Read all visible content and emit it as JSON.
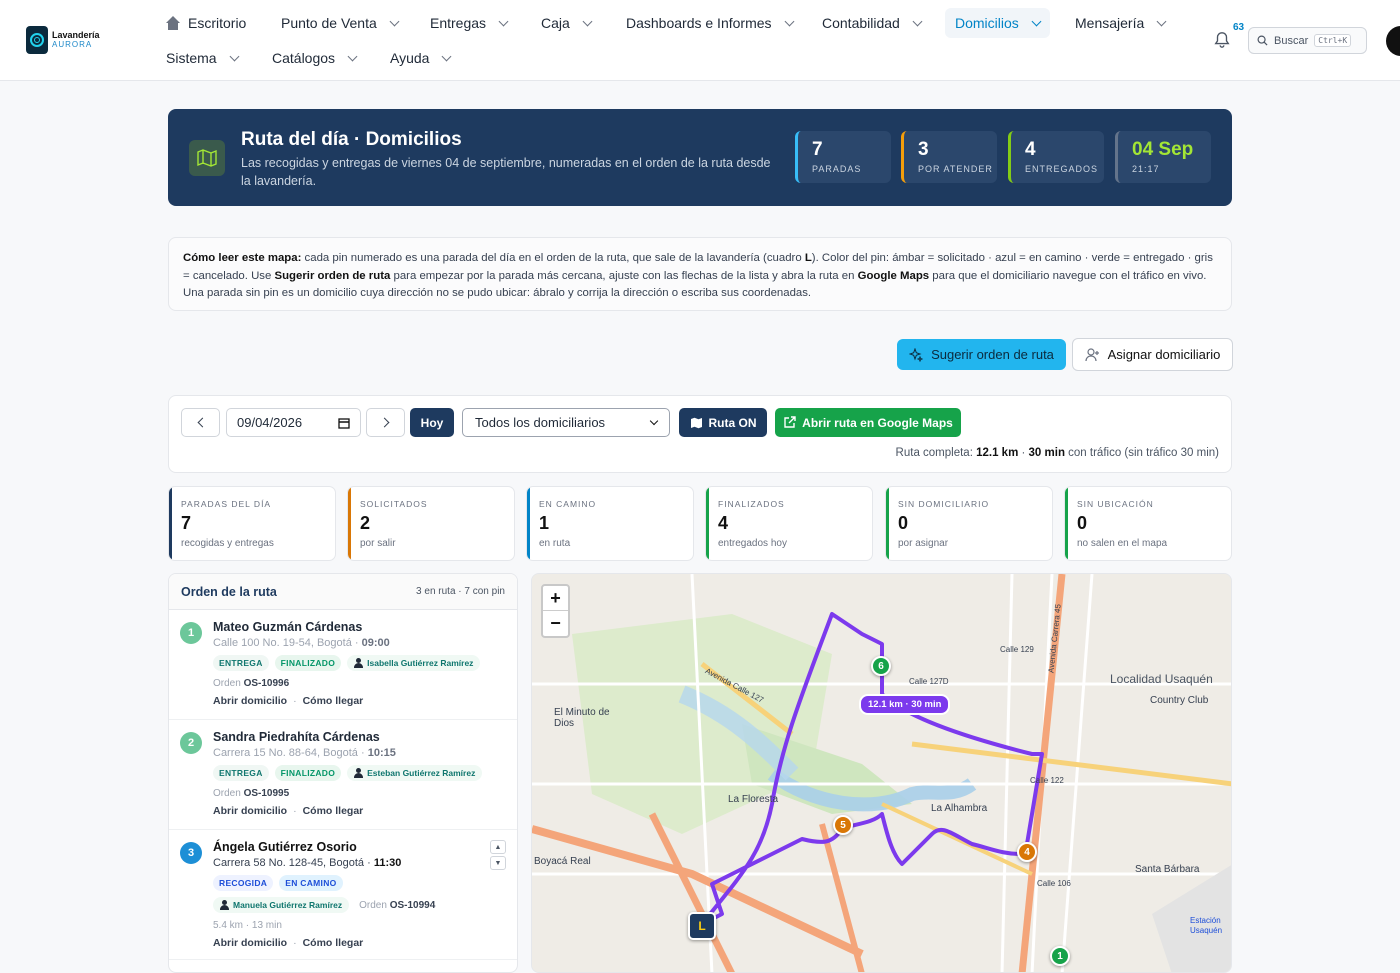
{
  "brand": {
    "name_line1": "Lavandería",
    "name_line2": "AURORA"
  },
  "nav": {
    "row1": [
      {
        "label": "Escritorio"
      },
      {
        "label": "Punto de Venta"
      },
      {
        "label": "Entregas"
      },
      {
        "label": "Caja"
      },
      {
        "label": "Dashboards e Informes"
      },
      {
        "label": "Contabilidad"
      },
      {
        "label": "Domicilios",
        "active": true
      },
      {
        "label": "Mensajería"
      }
    ],
    "row2": [
      {
        "label": "Sistema"
      },
      {
        "label": "Catálogos"
      },
      {
        "label": "Ayuda"
      }
    ]
  },
  "header": {
    "notifications": "63",
    "search_label": "Buscar",
    "search_shortcut": "Ctrl+K"
  },
  "hero": {
    "title": "Ruta del día · Domicilios",
    "subtitle": "Las recogidas y entregas de viernes 04 de septiembre, numeradas en el orden de la ruta desde la lavandería.",
    "stats": [
      {
        "value": "7",
        "label": "PARADAS",
        "color": "#38bdf8"
      },
      {
        "value": "3",
        "label": "POR ATENDER",
        "color": "#f59e0b"
      },
      {
        "value": "4",
        "label": "ENTREGADOS",
        "color": "#84cc16"
      },
      {
        "value": "04 Sep",
        "label": "21:17",
        "color": "#84cc16"
      }
    ]
  },
  "howto": {
    "lead": "Cómo leer este mapa:",
    "p1": " cada pin numerado es una parada del día en el orden de la ruta, que sale de la lavandería (cuadro ",
    "L": "L",
    "p2": "). Color del pin: ámbar = solicitado · azul = en camino · verde = entregado · gris = cancelado. Use ",
    "b1": "Sugerir orden de ruta",
    "p3": " para empezar por la parada más cercana, ajuste con las flechas de la lista y abra la ruta en ",
    "b2": "Google Maps",
    "p4": " para que el domiciliario navegue con el tráfico en vivo. Una parada sin pin es un domicilio cuya dirección no se pudo ubicar: ábralo y corrija la dirección o escriba sus coordenadas."
  },
  "actions": {
    "suggest": "Sugerir orden de ruta",
    "assign": "Asignar domiciliario"
  },
  "toolbar": {
    "date": "09/04/2026",
    "today": "Hoy",
    "courier_select": "Todos los domiciliarios",
    "route_toggle": "Ruta ON",
    "gmaps": "Abrir ruta en Google Maps",
    "total_prefix": "Ruta completa: ",
    "total_km": "12.1 km",
    "total_sep": " · ",
    "total_min": "30 min",
    "total_suffix": " con tráfico (sin tráfico 30 min)"
  },
  "kpis": [
    {
      "title": "PARADAS DEL DÍA",
      "value": "7",
      "sub": "recogidas y entregas",
      "color": "#1e3a5f"
    },
    {
      "title": "SOLICITADOS",
      "value": "2",
      "sub": "por salir",
      "color": "#d97706"
    },
    {
      "title": "EN CAMINO",
      "value": "1",
      "sub": "en ruta",
      "color": "#0284c7"
    },
    {
      "title": "FINALIZADOS",
      "value": "4",
      "sub": "entregados hoy",
      "color": "#16a34a"
    },
    {
      "title": "SIN DOMICILIARIO",
      "value": "0",
      "sub": "por asignar",
      "color": "#16a34a"
    },
    {
      "title": "SIN UBICACIÓN",
      "value": "0",
      "sub": "no salen en el mapa",
      "color": "#16a34a"
    }
  ],
  "route": {
    "title": "Orden de la ruta",
    "count": "3 en ruta · 7 con pin",
    "stops": [
      {
        "num": "1",
        "color": "#6cc79a",
        "name": "Mateo Guzmán Cárdenas",
        "addr": "Calle 100 No. 19-54, Bogotá · ",
        "time": "09:00",
        "type": "ENTREGA",
        "status": "FINALIZADO",
        "courier": "Isabella Gutiérrez Ramírez",
        "order_label": "Orden ",
        "order": "OS-10996",
        "open": "Abrir domicilio",
        "howto": "Cómo llegar"
      },
      {
        "num": "2",
        "color": "#6cc79a",
        "name": "Sandra Piedrahíta Cárdenas",
        "addr": "Carrera 15 No. 88-64, Bogotá · ",
        "time": "10:15",
        "type": "ENTREGA",
        "status": "FINALIZADO",
        "courier": "Esteban Gutiérrez Ramírez",
        "order_label": "Orden ",
        "order": "OS-10995",
        "open": "Abrir domicilio",
        "howto": "Cómo llegar"
      },
      {
        "num": "3",
        "color": "#1d8fd6",
        "name": "Ángela Gutiérrez Osorio",
        "addr": "Carrera 58 No. 128-45, Bogotá · ",
        "time": "11:30",
        "type": "RECOGIDA",
        "status": "EN CAMINO",
        "courier": "Manuela Gutiérrez Ramírez",
        "order_label": "Orden ",
        "order": "OS-10994",
        "meta": "5.4 km · 13 min",
        "open": "Abrir domicilio",
        "howto": "Cómo llegar"
      }
    ]
  },
  "map": {
    "route_label": "12.1 km · 30 min",
    "pins": [
      {
        "label": "6",
        "color": "#16a34a"
      },
      {
        "label": "5",
        "color": "#d97706"
      },
      {
        "label": "4",
        "color": "#d97706"
      },
      {
        "label": "1",
        "color": "#16a34a"
      }
    ],
    "start": "L",
    "place_labels": [
      "Localidad Usaquén",
      "Country Club",
      "El Minuto de Dios",
      "La Floresta",
      "La Alhambra",
      "Boyacá Real",
      "Santa Bárbara",
      "Calle 129",
      "Calle 127D",
      "Avenida Calle 127",
      "Calle 122",
      "Calle 106",
      "Avenida Carrera 45",
      "Estación Usaquén"
    ]
  }
}
